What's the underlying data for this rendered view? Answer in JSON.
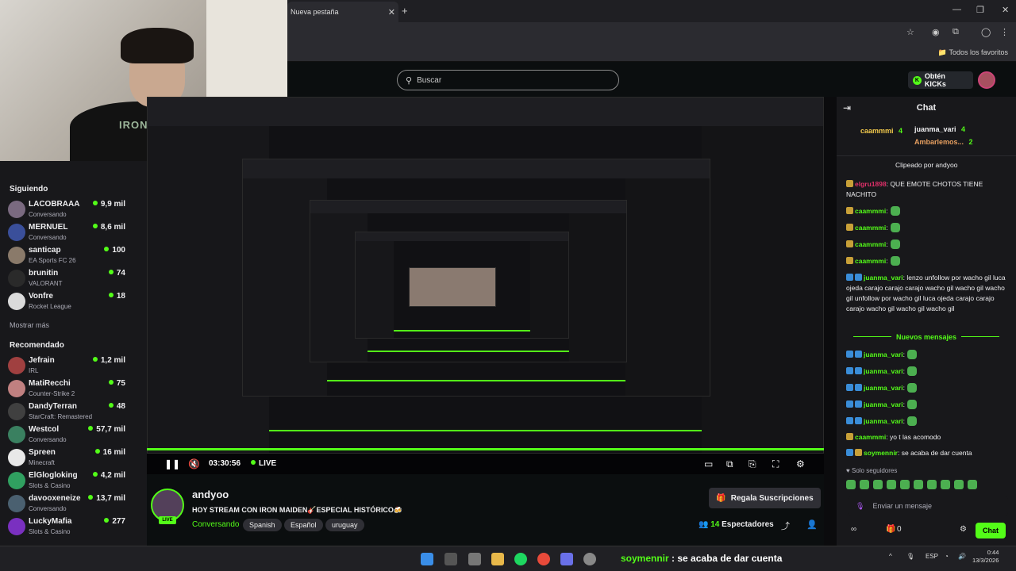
{
  "browser": {
    "tab_title": "Nueva pestaña",
    "bookmarks_label": "Todos los favoritos"
  },
  "header": {
    "search_placeholder": "Buscar",
    "kicks_button": "Obtén KICKs"
  },
  "webcam": {
    "shirt_text": "IRON MAIDEN"
  },
  "sidebar": {
    "following_title": "Siguiendo",
    "following": [
      {
        "name": "LACOBRAAA",
        "category": "Conversando",
        "viewers": "9,9 mil",
        "color": "#7a6a80"
      },
      {
        "name": "MERNUEL",
        "category": "Conversando",
        "viewers": "8,6 mil",
        "color": "#3a4f9a"
      },
      {
        "name": "santicap",
        "category": "EA Sports FC 26",
        "viewers": "100",
        "color": "#8a7a6a"
      },
      {
        "name": "brunitin",
        "category": "VALORANT",
        "viewers": "74",
        "color": "#2a2a2a"
      },
      {
        "name": "Vonfre",
        "category": "Rocket League",
        "viewers": "18",
        "color": "#dadada"
      }
    ],
    "show_more": "Mostrar más",
    "recommended_title": "Recomendado",
    "recommended": [
      {
        "name": "Jefrain",
        "category": "IRL",
        "viewers": "1,2 mil",
        "color": "#a04040"
      },
      {
        "name": "MatiRecchi",
        "category": "Counter-Strike 2",
        "viewers": "75",
        "color": "#c08080"
      },
      {
        "name": "DandyTerran",
        "category": "StarCraft: Remastered",
        "viewers": "48",
        "color": "#404040"
      },
      {
        "name": "Westcol",
        "category": "Conversando",
        "viewers": "57,7 mil",
        "color": "#3a8060"
      },
      {
        "name": "Spreen",
        "category": "Minecraft",
        "viewers": "16 mil",
        "color": "#e8e8e8"
      },
      {
        "name": "ElGlogloking",
        "category": "Slots & Casino",
        "viewers": "4,2 mil",
        "color": "#30a060"
      },
      {
        "name": "davooxeneize",
        "category": "Conversando",
        "viewers": "13,7 mil",
        "color": "#4a6070"
      },
      {
        "name": "LuckyMafia",
        "category": "Slots & Casino",
        "viewers": "277",
        "color": "#7a30c0"
      }
    ]
  },
  "player": {
    "time": "03:30:56",
    "live": "LIVE",
    "progress": 1.0
  },
  "stream": {
    "streamer": "andyoo",
    "live_badge": "LIVE",
    "title": "HOY STREAM CON IRON MAIDEN🎸ESPECIAL HISTÓRICO🍻",
    "category": "Conversando",
    "tags": [
      "Spanish",
      "Español",
      "uruguay"
    ],
    "gift_button": "Regala Suscripciones",
    "viewers_count": "14",
    "viewers_label": "Espectadores"
  },
  "chat": {
    "title": "Chat",
    "gifters": [
      {
        "name": "caammmi",
        "count": "4"
      },
      {
        "name": "juanma_vari",
        "count": "4"
      },
      {
        "name": "Ambarlemos...",
        "count": "2"
      }
    ],
    "clip_line": "Clipeado por andyoo",
    "messages": [
      {
        "user": "elgru1898",
        "color": "#e0306a",
        "text": "QUE EMOTE CHOTOS TIENE NACHITO"
      },
      {
        "user": "caammmi",
        "color": "#53fc18",
        "text": ""
      },
      {
        "user": "caammmi",
        "color": "#53fc18",
        "text": ""
      },
      {
        "user": "caammmi",
        "color": "#53fc18",
        "text": ""
      },
      {
        "user": "caammmi",
        "color": "#53fc18",
        "text": ""
      },
      {
        "user": "juanma_vari",
        "color": "#53fc18",
        "text": "lenzo unfollow por wacho gil luca ojeda carajo carajo carajo wacho gil wacho gil wacho gil unfollow por wacho gil luca ojeda carajo carajo carajo wacho gil wacho gil wacho gil"
      }
    ],
    "new_messages": "Nuevos mensajes",
    "new": [
      {
        "user": "juanma_vari",
        "color": "#53fc18",
        "text": ""
      },
      {
        "user": "juanma_vari",
        "color": "#53fc18",
        "text": ""
      },
      {
        "user": "juanma_vari",
        "color": "#53fc18",
        "text": ""
      },
      {
        "user": "juanma_vari",
        "color": "#53fc18",
        "text": ""
      },
      {
        "user": "juanma_vari",
        "color": "#53fc18",
        "text": ""
      },
      {
        "user": "caammmi",
        "color": "#53fc18",
        "text": "yo t las acomodo"
      },
      {
        "user": "soymennir",
        "color": "#53fc18",
        "text": "se acaba de dar cuenta"
      }
    ],
    "followers_only": "Solo seguidores",
    "input_placeholder": "Enviar un mensaje",
    "points": "0",
    "send": "Chat"
  },
  "taskbar": {
    "ticker_user": "soymennir",
    "ticker_text": "se acaba de dar cuenta",
    "lang": "ESP",
    "time": "0:44",
    "date": "13/3/2026"
  }
}
